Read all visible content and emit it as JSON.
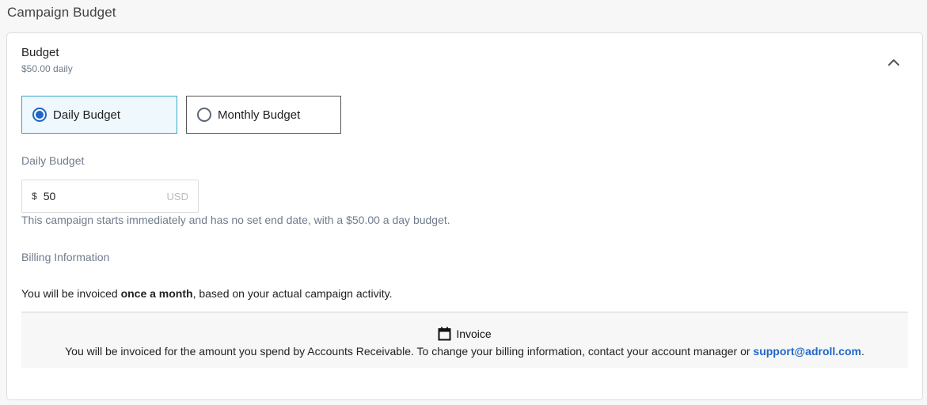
{
  "section_title": "Campaign Budget",
  "budget": {
    "title": "Budget",
    "summary": "$50.00 daily"
  },
  "options": [
    {
      "label": "Daily Budget",
      "selected": true
    },
    {
      "label": "Monthly Budget",
      "selected": false
    }
  ],
  "daily_budget": {
    "label": "Daily Budget",
    "prefix": "$",
    "value": "50",
    "suffix": "USD"
  },
  "help_text": "This campaign starts immediately and has no set end date, with a $50.00 a day budget.",
  "billing": {
    "label": "Billing Information",
    "note_before": "You will be invoiced ",
    "note_bold": "once a month",
    "note_after": ", based on your actual campaign activity.",
    "invoice_title": "Invoice",
    "invoice_text": "You will be invoiced for the amount you spend by Accounts Receivable. To change your billing information, contact your account manager or ",
    "support_email": "support@adroll.com",
    "invoice_period": "."
  },
  "icons": {
    "collapse": "chevron-up-icon",
    "invoice": "calendar-icon"
  },
  "colors": {
    "accent": "#1f66c7",
    "selected_border": "#35a8cc",
    "selected_bg": "#eef8fd",
    "muted_text": "#6f7c8c"
  }
}
